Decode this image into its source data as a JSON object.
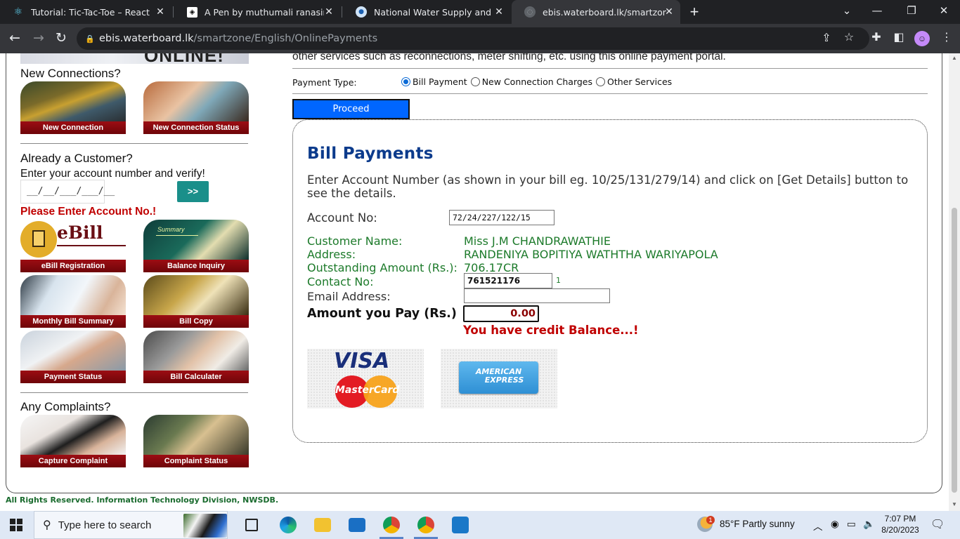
{
  "browser": {
    "tabs": [
      {
        "title": "Tutorial: Tic-Tac-Toe – React",
        "active": false
      },
      {
        "title": "A Pen by muthumali ranasinghe",
        "active": false
      },
      {
        "title": "National Water Supply and Drain",
        "active": false
      },
      {
        "title": "ebis.waterboard.lk/smartzone/En",
        "active": true
      }
    ],
    "url_host": "ebis.waterboard.lk",
    "url_path": "/smartzone/English/OnlinePayments"
  },
  "sidebar": {
    "banner_text": "ONLINE!",
    "new_connections_heading": "New Connections?",
    "new_connection_tiles": [
      {
        "label": "New Connection"
      },
      {
        "label": "New Connection Status"
      }
    ],
    "customer_heading": "Already a Customer?",
    "customer_sub": "Enter your account number and verify!",
    "account_input_placeholder": "__/__/___/___/__",
    "verify_button": ">>",
    "error_text": "Please Enter Account No.!",
    "service_tiles": [
      {
        "label": "eBill Registration"
      },
      {
        "label": "Balance Inquiry"
      },
      {
        "label": "Monthly Bill Summary"
      },
      {
        "label": "Bill Copy"
      },
      {
        "label": "Payment Status"
      },
      {
        "label": "Bill Calculater"
      }
    ],
    "ebill_logo_text": "eBill",
    "summary_logo_text": "Summary",
    "complaints_heading": "Any Complaints?",
    "complaint_tiles": [
      {
        "label": "Capture Complaint"
      },
      {
        "label": "Complaint Status"
      }
    ]
  },
  "main": {
    "intro_text": "other services such as reconnections, meter shifting, etc. using this online payment portal.",
    "payment_type_label": "Payment Type:",
    "payment_types": [
      {
        "label": "Bill Payment",
        "selected": true
      },
      {
        "label": "New Connection Charges",
        "selected": false
      },
      {
        "label": "Other Services",
        "selected": false
      }
    ],
    "proceed_button": "Proceed",
    "bill": {
      "title": "Bill Payments",
      "description": "Enter Account Number (as shown in your bill eg. 10/25/131/279/14) and click on [Get Details] button to see the details.",
      "account_label": "Account No:",
      "account_value": "72/24/227/122/15",
      "customer_name_label": "Customer Name:",
      "customer_name": "Miss J.M CHANDRAWATHIE",
      "address_label": "Address:",
      "address": "RANDENIYA BOPITIYA WATHTHA WARIYAPOLA",
      "outstanding_label": "Outstanding Amount (Rs.):",
      "outstanding": "706.17CR",
      "contact_label": "Contact No:",
      "contact_value": "761521176",
      "contact_note": "1",
      "email_label": "Email Address:",
      "email_value": "",
      "pay_label": "Amount you Pay (Rs.)",
      "pay_value": "0.00",
      "credit_msg": "You have credit Balance...!"
    },
    "cards": {
      "visa": "VISA",
      "mastercard": "MasterCard",
      "amex_line1": "AMERICAN",
      "amex_line2": "EXPRESS"
    }
  },
  "footer": {
    "text": "All Rights Reserved. Information Technology Division, NWSDB."
  },
  "taskbar": {
    "search_placeholder": "Type here to search",
    "weather": "85°F  Partly sunny",
    "weather_badge": "1",
    "time": "7:07 PM",
    "date": "8/20/2023"
  },
  "colors": {
    "accent_blue": "#0066ff",
    "title_blue": "#0c3b8c",
    "error_red": "#c00000",
    "value_green": "#1c7a2a",
    "tile_caption": "#9c0d13"
  }
}
